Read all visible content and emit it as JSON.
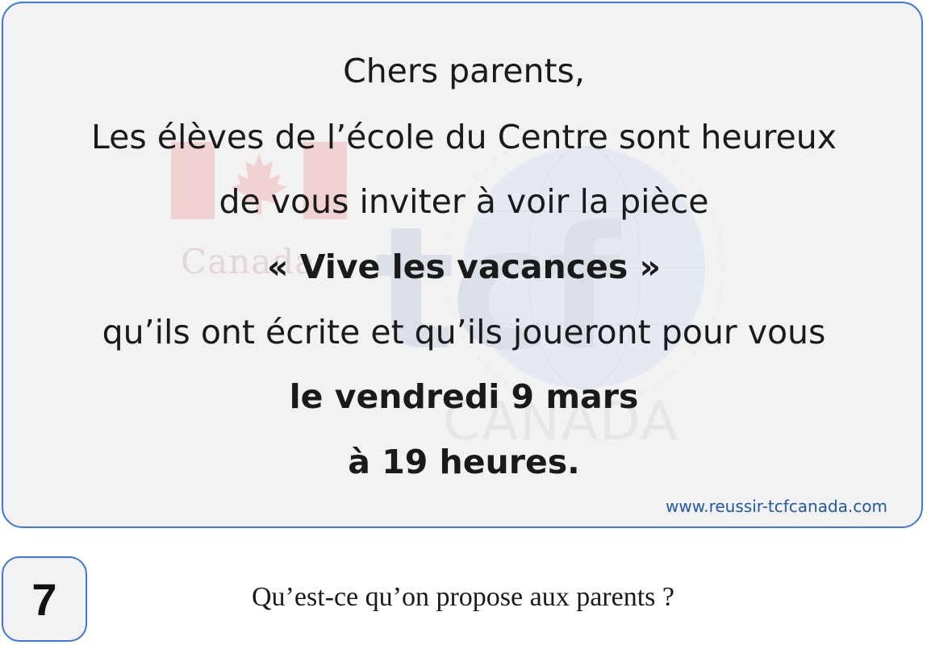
{
  "message": {
    "lines": [
      {
        "text": "Chers parents,",
        "bold": false
      },
      {
        "text": "Les élèves de l’école du Centre sont heureux",
        "bold": false
      },
      {
        "text": "de vous inviter à voir la pièce",
        "bold": false
      },
      {
        "text": "« Vive les vacances »",
        "bold": true
      },
      {
        "text": "qu’ils ont écrite et qu’ils joueront pour vous",
        "bold": false
      },
      {
        "text": "le vendredi 9 mars",
        "bold": true
      },
      {
        "text": "à 19 heures.",
        "bold": true
      }
    ]
  },
  "watermark": {
    "logo_text": "tcf",
    "country_word": "Canada",
    "country_caps": "CANADA",
    "icons": [
      "canada-flag-icon",
      "globe-icon"
    ]
  },
  "website": "www.reussir-tcfcanada.com",
  "question": {
    "number": "7",
    "text": "Qu’est-ce qu’on propose aux parents ?"
  },
  "colors": {
    "border": "#3b77e6",
    "card_bg": "#f2f2f2",
    "link": "#1f5aa8",
    "text": "#1a1a1a"
  }
}
